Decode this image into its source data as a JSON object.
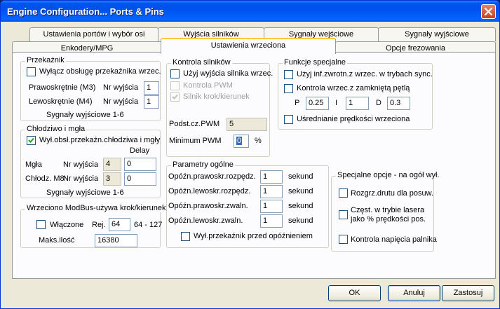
{
  "window": {
    "title": "Engine Configuration... Ports & Pins"
  },
  "tabs_row1": [
    {
      "label": "Ustawienia portów i wybór osi"
    },
    {
      "label": "Wyjścia silników"
    },
    {
      "label": "Sygnały wejściowe"
    },
    {
      "label": "Sygnały wyjściowe"
    }
  ],
  "tabs_row2": [
    {
      "label": "Enkodery/MPG"
    },
    {
      "label": "Ustawienia wrzeciona",
      "active": true
    },
    {
      "label": "Opcje frezowania"
    }
  ],
  "relay": {
    "title": "Przekaźnik",
    "disable_label": "Wyłącz obsługę przekaźnika wrzec.",
    "disable_checked": false,
    "cw_label": "Prawoskrętnie  (M3)",
    "cw_pin_label": "Nr wyjścia",
    "cw_pin": "1",
    "ccw_label": "Lewoskrętnie  (M4)",
    "ccw_pin_label": "Nr wyjścia",
    "ccw_pin": "1",
    "footer": "Sygnały wyjściowe 1-6"
  },
  "coolant": {
    "title": "Chłodziwo i mgła",
    "disable_label": "Wył.obsł.przekaźn.chłodziwa i mgły",
    "disable_checked": true,
    "delay_header": "Delay",
    "mist_label": "Mgła",
    "mist_pin_label": "Nr wyjścia",
    "mist_pin": "4",
    "mist_delay": "0",
    "flood_label": "Chłodz. M8",
    "flood_pin_label": "Nr wyjścia",
    "flood_pin": "3",
    "flood_delay": "0",
    "footer": "Sygnały wyjściowe 1-6"
  },
  "modbus": {
    "title": "Wrzeciono ModBus-używa krok/kierunek",
    "enabled_label": "Włączone",
    "enabled_checked": false,
    "reg_label": "Rej.",
    "reg_value": "64",
    "reg_range": "64 - 127",
    "max_label": "Maks.ilość",
    "max_value": "16380"
  },
  "motor_control": {
    "title": "Kontrola silników",
    "use_outputs_label": "Użyj wyjścia silnika wrzec.",
    "use_outputs_checked": false,
    "pwm_label": "Kontrola PWM",
    "pwm_checked": false,
    "stepdir_label": "Silnik krok/kierunek",
    "stepdir_checked": true,
    "pwm_base_label": "Podst.cz.PWM",
    "pwm_base_value": "5",
    "min_pwm_label": "Minimum PWM",
    "min_pwm_value": "0",
    "min_pwm_unit": "%"
  },
  "special_functions": {
    "title": "Funkcje specjalne",
    "feedback_label": "Użyj inf.zwrotn.z wrzec. w trybach sync.",
    "feedback_checked": false,
    "closed_loop_label": "Kontrola wrzec.z zamkniętą pętlą",
    "closed_loop_checked": false,
    "p_label": "P",
    "p_value": "0.25",
    "i_label": "I",
    "i_value": "1",
    "d_label": "D",
    "d_value": "0.3",
    "averaging_label": "Uśrednianie prędkości wrzeciona",
    "averaging_checked": false
  },
  "general": {
    "title": "Parametry ogólne",
    "cw_spinup_label": "Opóźn.prawoskr.rozpędz.",
    "cw_spinup_value": "1",
    "ccw_spinup_label": "Opóźn.lewoskr.rozpędz.",
    "ccw_spinup_value": "1",
    "cw_spindown_label": "Opóźn.prawoskr.zwaln.",
    "cw_spindown_value": "1",
    "ccw_spindown_label": "Opóźn.lewoskr.zwaln.",
    "ccw_spindown_value": "1",
    "unit": "sekund",
    "relay_before_delay_label": "Wył.przekaźnik przed opóźnieniem",
    "relay_before_delay_checked": false
  },
  "special_options": {
    "title": "Specjalne opcje - na ogół wył.",
    "hotwire_label": "Rozgrz.drutu dla posuw.",
    "hotwire_checked": false,
    "laser_label_line1": "Częst. w trybie lasera",
    "laser_label_line2": "jako % prędkości pos.",
    "laser_checked": false,
    "torch_label": "Kontrola napięcia palnika",
    "torch_checked": false
  },
  "buttons": {
    "ok": "OK",
    "cancel": "Anuluj",
    "apply": "Zastosuj"
  }
}
